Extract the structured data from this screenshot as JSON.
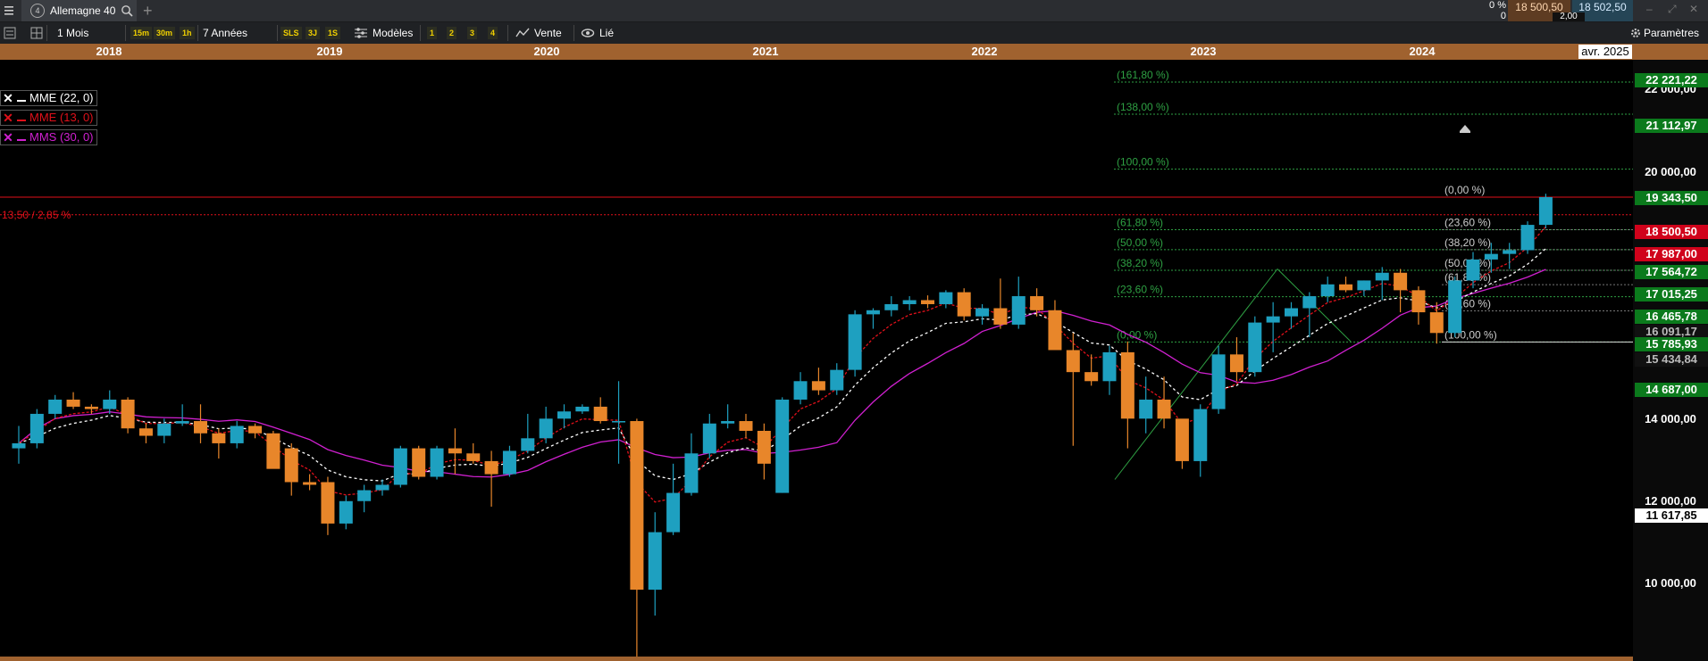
{
  "window": {
    "menu_icon": "hamburger-icon",
    "tab_number": "4",
    "tab_title": "Allemagne 40",
    "search_icon": "search-icon",
    "new_tab_symbol": "+",
    "change_pct": "0 %",
    "change_abs": "0",
    "bid": "18 500,50",
    "ask": "18 502,50",
    "spread": "2,00"
  },
  "toolbar": {
    "period": "1 Mois",
    "timeframes": [
      "15m",
      "30m",
      "1h"
    ],
    "range": "7 Années",
    "shortcuts": [
      "SLS",
      "3J",
      "1S"
    ],
    "models_label": "Modèles",
    "layouts": [
      "1",
      "2",
      "3",
      "4"
    ],
    "sell_label": "Vente",
    "linked_label": "Lié",
    "settings_label": "Paramètres"
  },
  "timeline": {
    "years": [
      "2018",
      "2019",
      "2020",
      "2021",
      "2022",
      "2023",
      "2024"
    ],
    "cursor_date": "avr. 2025"
  },
  "legend": [
    {
      "label": "MME (22, 0)",
      "color": "#ffffff"
    },
    {
      "label": "MME (13, 0)",
      "color": "#e0101a"
    },
    {
      "label": "MMS (30, 0)",
      "color": "#d020d0"
    }
  ],
  "annotation": "13,50 / 2,85 %",
  "axis": {
    "labels": [
      "22 000,00",
      "20 000,00",
      "14 000,00",
      "12 000,00",
      "10 000,00"
    ]
  },
  "price_tags": [
    {
      "value": "22 221,22",
      "style": "green"
    },
    {
      "value": "21 112,97",
      "style": "green"
    },
    {
      "value": "19 343,50",
      "style": "green"
    },
    {
      "value": "18 500,50",
      "style": "red"
    },
    {
      "value": "17 987,00",
      "style": "red"
    },
    {
      "value": "17 564,72",
      "style": "green"
    },
    {
      "value": "17 015,25",
      "style": "green"
    },
    {
      "value": "16 465,78",
      "style": "green"
    },
    {
      "value": "16 091,17",
      "style": "grey"
    },
    {
      "value": "15 785,93",
      "style": "green"
    },
    {
      "value": "15 434,84",
      "style": "grey"
    },
    {
      "value": "14 687,00",
      "style": "green"
    },
    {
      "value": "11 617,85",
      "style": "white"
    }
  ],
  "fib_extension_labels": [
    "(161,80 %)",
    "(138,00 %)",
    "(100,00 %)",
    "(61,80 %)",
    "(50,00 %)",
    "(38,20 %)",
    "(23,60 %)",
    "(0,00 %)"
  ],
  "fib_retracement_labels": [
    "(0,00 %)",
    "(23,60 %)",
    "(38,20 %)",
    "(50,00 %)",
    "(61,80 %)",
    "(78,60 %)",
    "(100,00 %)"
  ],
  "colors": {
    "bull": "#1ea0c0",
    "bear": "#e8862a",
    "timeline": "#a0622f",
    "fib_green": "#2ea043",
    "current_price_line": "#e0101a"
  },
  "chart_data": {
    "type": "candlestick",
    "timeframe": "1 Mois",
    "instrument": "Allemagne 40",
    "ylim": [
      9200,
      22700
    ],
    "y_scale": "log",
    "candles": [
      {
        "o": 12400,
        "h": 12850,
        "l": 12100,
        "c": 12500
      },
      {
        "o": 12500,
        "h": 13200,
        "l": 12400,
        "c": 13100
      },
      {
        "o": 13100,
        "h": 13500,
        "l": 13000,
        "c": 13400
      },
      {
        "o": 13400,
        "h": 13560,
        "l": 13200,
        "c": 13250
      },
      {
        "o": 13250,
        "h": 13300,
        "l": 13100,
        "c": 13200
      },
      {
        "o": 13200,
        "h": 13600,
        "l": 13100,
        "c": 13400
      },
      {
        "o": 13400,
        "h": 13450,
        "l": 12700,
        "c": 12800
      },
      {
        "o": 12800,
        "h": 12900,
        "l": 12500,
        "c": 12650
      },
      {
        "o": 12650,
        "h": 13000,
        "l": 12500,
        "c": 12900
      },
      {
        "o": 12900,
        "h": 13300,
        "l": 12850,
        "c": 12950
      },
      {
        "o": 12950,
        "h": 13300,
        "l": 12500,
        "c": 12700
      },
      {
        "o": 12700,
        "h": 12800,
        "l": 12200,
        "c": 12500
      },
      {
        "o": 12500,
        "h": 12950,
        "l": 12400,
        "c": 12850
      },
      {
        "o": 12850,
        "h": 12900,
        "l": 12600,
        "c": 12700
      },
      {
        "o": 12700,
        "h": 12750,
        "l": 12200,
        "c": 12000
      },
      {
        "o": 12400,
        "h": 12500,
        "l": 11500,
        "c": 11750
      },
      {
        "o": 11750,
        "h": 11900,
        "l": 11600,
        "c": 11700
      },
      {
        "o": 11750,
        "h": 11850,
        "l": 10800,
        "c": 11000
      },
      {
        "o": 11000,
        "h": 11500,
        "l": 10900,
        "c": 11400
      },
      {
        "o": 11400,
        "h": 11700,
        "l": 11200,
        "c": 11600
      },
      {
        "o": 11600,
        "h": 11800,
        "l": 11500,
        "c": 11700
      },
      {
        "o": 11700,
        "h": 12450,
        "l": 11650,
        "c": 12400
      },
      {
        "o": 12400,
        "h": 12450,
        "l": 11800,
        "c": 11850
      },
      {
        "o": 11850,
        "h": 12450,
        "l": 11800,
        "c": 12400
      },
      {
        "o": 12400,
        "h": 12800,
        "l": 11900,
        "c": 12300
      },
      {
        "o": 12300,
        "h": 12500,
        "l": 12100,
        "c": 12150
      },
      {
        "o": 12150,
        "h": 12350,
        "l": 11300,
        "c": 11900
      },
      {
        "o": 11900,
        "h": 12450,
        "l": 11850,
        "c": 12350
      },
      {
        "o": 12350,
        "h": 13100,
        "l": 12300,
        "c": 12600
      },
      {
        "o": 12600,
        "h": 13250,
        "l": 12500,
        "c": 13000
      },
      {
        "o": 13000,
        "h": 13300,
        "l": 12800,
        "c": 13150
      },
      {
        "o": 13150,
        "h": 13300,
        "l": 13100,
        "c": 13250
      },
      {
        "o": 13250,
        "h": 13450,
        "l": 12900,
        "c": 12950
      },
      {
        "o": 12950,
        "h": 13800,
        "l": 12100,
        "c": 12950
      },
      {
        "o": 12950,
        "h": 13000,
        "l": 8300,
        "c": 9900
      },
      {
        "o": 9900,
        "h": 11200,
        "l": 9500,
        "c": 10850
      },
      {
        "o": 10850,
        "h": 12100,
        "l": 10800,
        "c": 11550
      },
      {
        "o": 11550,
        "h": 12700,
        "l": 11500,
        "c": 12300
      },
      {
        "o": 12300,
        "h": 13100,
        "l": 12200,
        "c": 12900
      },
      {
        "o": 12900,
        "h": 13300,
        "l": 12800,
        "c": 12950
      },
      {
        "o": 12950,
        "h": 13100,
        "l": 12600,
        "c": 12750
      },
      {
        "o": 12750,
        "h": 12900,
        "l": 11800,
        "c": 12100
      },
      {
        "o": 11550,
        "h": 13450,
        "l": 11550,
        "c": 13400
      },
      {
        "o": 13400,
        "h": 14000,
        "l": 13300,
        "c": 13800
      },
      {
        "o": 13800,
        "h": 14100,
        "l": 13500,
        "c": 13600
      },
      {
        "o": 13600,
        "h": 14200,
        "l": 13500,
        "c": 14050
      },
      {
        "o": 14050,
        "h": 15450,
        "l": 13900,
        "c": 15350
      },
      {
        "o": 15350,
        "h": 15500,
        "l": 15000,
        "c": 15450
      },
      {
        "o": 15450,
        "h": 15800,
        "l": 15300,
        "c": 15600
      },
      {
        "o": 15600,
        "h": 15800,
        "l": 15450,
        "c": 15700
      },
      {
        "o": 15700,
        "h": 15820,
        "l": 15500,
        "c": 15600
      },
      {
        "o": 15600,
        "h": 15950,
        "l": 15500,
        "c": 15900
      },
      {
        "o": 15900,
        "h": 16000,
        "l": 15200,
        "c": 15300
      },
      {
        "o": 15300,
        "h": 15600,
        "l": 15100,
        "c": 15500
      },
      {
        "o": 15500,
        "h": 16250,
        "l": 15000,
        "c": 15100
      },
      {
        "o": 15100,
        "h": 16300,
        "l": 15000,
        "c": 15800
      },
      {
        "o": 15800,
        "h": 16000,
        "l": 15300,
        "c": 15450
      },
      {
        "o": 15450,
        "h": 15700,
        "l": 14600,
        "c": 14500
      },
      {
        "o": 14500,
        "h": 14900,
        "l": 12450,
        "c": 14000
      },
      {
        "o": 14000,
        "h": 14400,
        "l": 13700,
        "c": 13800
      },
      {
        "o": 13800,
        "h": 14600,
        "l": 13500,
        "c": 14450
      },
      {
        "o": 14450,
        "h": 14700,
        "l": 12400,
        "c": 13000
      },
      {
        "o": 13000,
        "h": 13900,
        "l": 12700,
        "c": 13400
      },
      {
        "o": 13400,
        "h": 13900,
        "l": 12800,
        "c": 13000
      },
      {
        "o": 13000,
        "h": 12800,
        "l": 12000,
        "c": 12150
      },
      {
        "o": 12150,
        "h": 13300,
        "l": 11850,
        "c": 13200
      },
      {
        "o": 13200,
        "h": 14600,
        "l": 13100,
        "c": 14400
      },
      {
        "o": 14400,
        "h": 14800,
        "l": 13800,
        "c": 14000
      },
      {
        "o": 14000,
        "h": 15300,
        "l": 13900,
        "c": 15150
      },
      {
        "o": 15150,
        "h": 15650,
        "l": 14450,
        "c": 15300
      },
      {
        "o": 15300,
        "h": 15650,
        "l": 15000,
        "c": 15500
      },
      {
        "o": 15500,
        "h": 15900,
        "l": 14800,
        "c": 15800
      },
      {
        "o": 15800,
        "h": 16300,
        "l": 15650,
        "c": 16100
      },
      {
        "o": 16100,
        "h": 16300,
        "l": 15900,
        "c": 15950
      },
      {
        "o": 15950,
        "h": 16200,
        "l": 15800,
        "c": 16200
      },
      {
        "o": 16200,
        "h": 16550,
        "l": 15700,
        "c": 16400
      },
      {
        "o": 16400,
        "h": 16500,
        "l": 15400,
        "c": 15950
      },
      {
        "o": 15950,
        "h": 16050,
        "l": 15100,
        "c": 15400
      },
      {
        "o": 15400,
        "h": 15650,
        "l": 14650,
        "c": 14900
      },
      {
        "o": 14900,
        "h": 16300,
        "l": 14800,
        "c": 16200
      },
      {
        "o": 16200,
        "h": 16950,
        "l": 16000,
        "c": 16750
      },
      {
        "o": 16750,
        "h": 17200,
        "l": 16400,
        "c": 16900
      },
      {
        "o": 16900,
        "h": 17200,
        "l": 16500,
        "c": 17000
      },
      {
        "o": 17000,
        "h": 17800,
        "l": 16900,
        "c": 17700
      },
      {
        "o": 17700,
        "h": 18600,
        "l": 17600,
        "c": 18500
      }
    ],
    "moving_averages": [
      {
        "name": "MME (22, 0)",
        "color": "#ffffff"
      },
      {
        "name": "MME (13, 0)",
        "color": "#e0101a"
      },
      {
        "name": "MMS (30, 0)",
        "color": "#d020d0"
      }
    ],
    "fib_extension_levels": [
      22221.22,
      21112.97,
      19343.5,
      17564.72,
      17015.25,
      16465.78,
      15785.93,
      14687.0
    ],
    "fib_retracement_levels": [
      18500.5,
      17564.72,
      17015.25,
      16465.78,
      16091.17,
      15434.84,
      14687.0
    ],
    "current_price": 18500.5,
    "previous_close": 17987.0
  }
}
